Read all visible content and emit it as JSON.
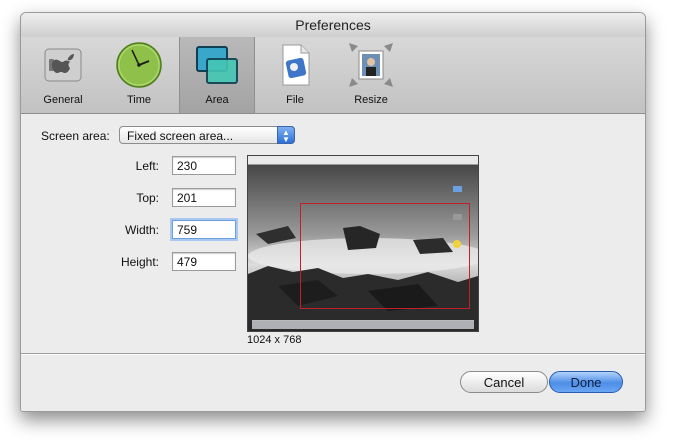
{
  "window": {
    "title": "Preferences"
  },
  "toolbar": {
    "items": [
      {
        "label": "General",
        "icon": "apple-switch-icon"
      },
      {
        "label": "Time",
        "icon": "clock-icon"
      },
      {
        "label": "Area",
        "icon": "overlapping-windows-icon",
        "selected": true
      },
      {
        "label": "File",
        "icon": "image-file-icon"
      },
      {
        "label": "Resize",
        "icon": "resize-photo-icon"
      }
    ]
  },
  "area": {
    "screen_area_label": "Screen area:",
    "screen_area_value": "Fixed screen area...",
    "left_label": "Left:",
    "left_value": "230",
    "top_label": "Top:",
    "top_value": "201",
    "width_label": "Width:",
    "width_value": "759",
    "height_label": "Height:",
    "height_value": "479",
    "resolution": "1024 x 768"
  },
  "buttons": {
    "cancel": "Cancel",
    "done": "Done"
  },
  "colors": {
    "accent": "#4d8ee7",
    "selection_rect": "#c0202a"
  }
}
